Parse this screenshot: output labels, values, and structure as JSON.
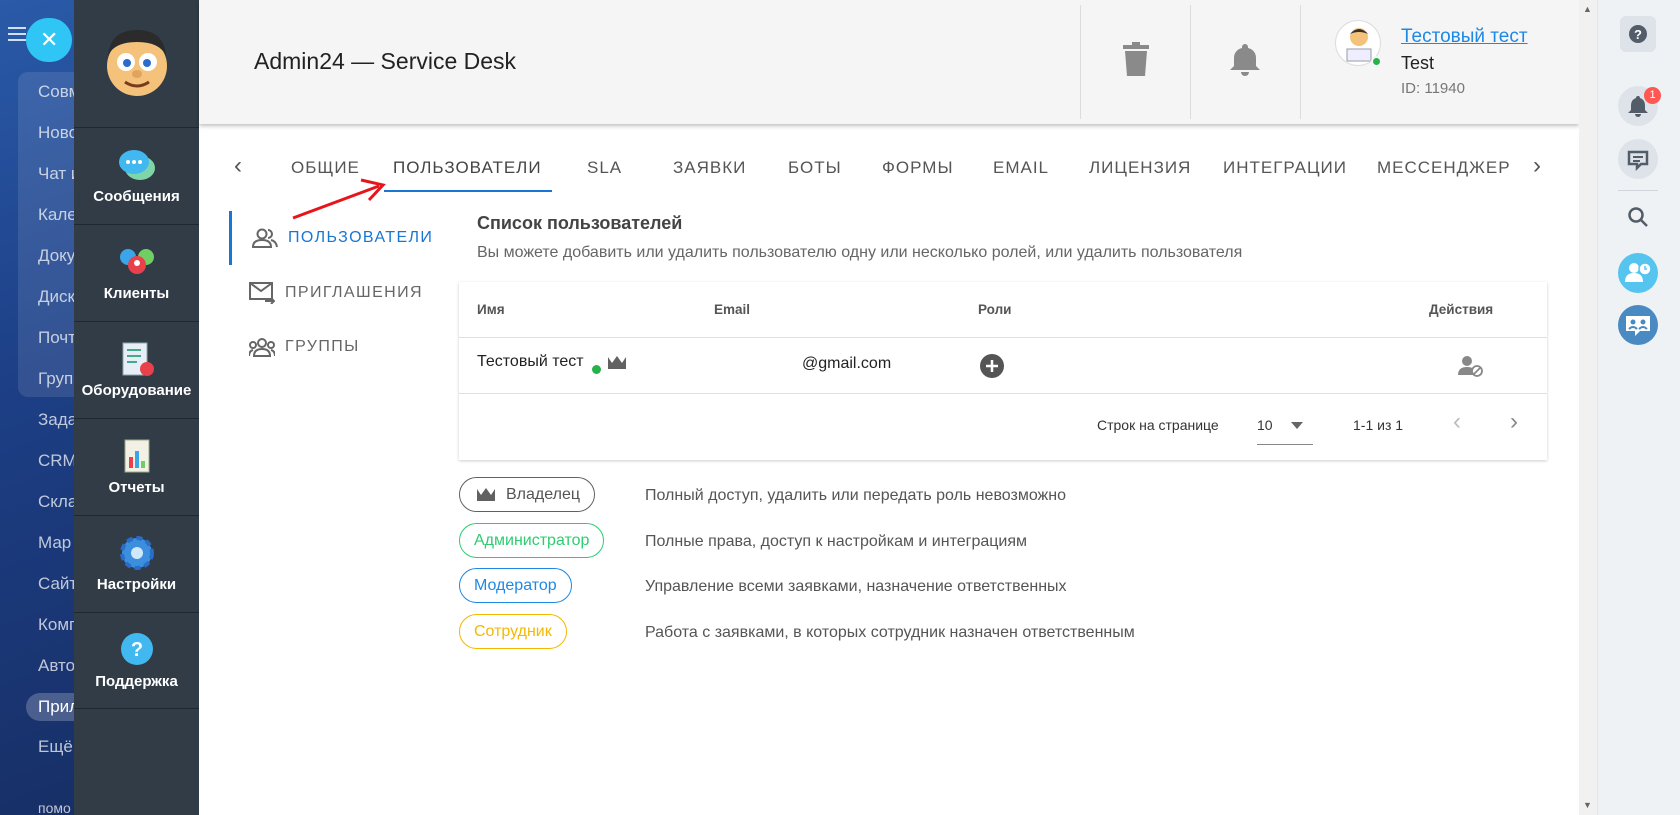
{
  "bitrix": {
    "menu": [
      "Совм",
      "Ново",
      "Чат и",
      "Кале",
      "Доку",
      "Диск",
      "Почт",
      "Груп",
      "Зада",
      "CRM",
      "Скла",
      "Мар",
      "Сайт",
      "Комп",
      "Авто",
      "Прил",
      "Ещё",
      "помо"
    ]
  },
  "appnav": {
    "items": [
      {
        "label": "Сообщения",
        "icon": "messages-icon"
      },
      {
        "label": "Клиенты",
        "icon": "clients-icon"
      },
      {
        "label": "Оборудование",
        "icon": "equipment-icon"
      },
      {
        "label": "Отчеты",
        "icon": "reports-icon"
      },
      {
        "label": "Настройки",
        "icon": "settings-icon"
      },
      {
        "label": "Поддержка",
        "icon": "support-icon"
      }
    ]
  },
  "header": {
    "title": "Admin24 — Service Desk",
    "user_name": "Тестовый тест",
    "user_sub": "Test",
    "user_id": "ID: 11940"
  },
  "tabs": [
    "ОБЩИЕ",
    "ПОЛЬЗОВАТЕЛИ",
    "SLA",
    "ЗАЯВКИ",
    "БОТЫ",
    "ФОРМЫ",
    "EMAIL",
    "ЛИЦЕНЗИЯ",
    "ИНТЕГРАЦИИ",
    "МЕССЕНДЖЕРЫ"
  ],
  "side_menu": [
    "ПОЛЬЗОВАТЕЛИ",
    "ПРИГЛАШЕНИЯ",
    "ГРУППЫ"
  ],
  "content": {
    "title": "Список пользователей",
    "description": "Вы можете добавить или удалить пользователю одну или несколько ролей, или удалить пользователя"
  },
  "table": {
    "headers": {
      "name": "Имя",
      "email": "Email",
      "roles": "Роли",
      "actions": "Действия"
    },
    "rows": [
      {
        "name": "Тестовый тест",
        "email": "@gmail.com"
      }
    ],
    "rows_per_page_label": "Строк на странице",
    "rows_per_page": "10",
    "range": "1-1 из 1"
  },
  "roles": [
    {
      "label": "Владелец",
      "desc": "Полный доступ, удалить или передать роль невозможно",
      "color": "#616161"
    },
    {
      "label": "Администратор",
      "desc": "Полные права, доступ к настройкам и интеграциям",
      "color": "#2ecc71"
    },
    {
      "label": "Модератор",
      "desc": "Управление всеми заявками, назначение ответственных",
      "color": "#1e88e5"
    },
    {
      "label": "Сотрудник",
      "desc": "Работа с заявками, в которых сотрудник назначен ответственным",
      "color": "#f5b800"
    }
  ],
  "rightbar": {
    "notif_count": "1"
  }
}
